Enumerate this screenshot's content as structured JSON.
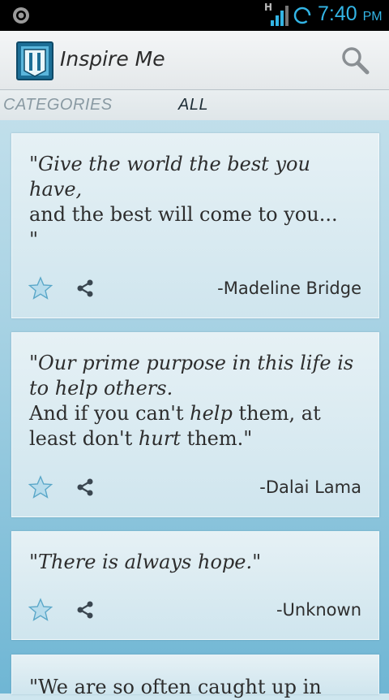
{
  "status_bar": {
    "network_type": "H",
    "time": "7:40",
    "ampm": "PM",
    "accent_color": "#33b5e5",
    "icons": [
      "notification-circle-icon",
      "signal-icon",
      "sync-icon"
    ]
  },
  "action_bar": {
    "title": "Inspire Me",
    "icons": [
      "app-logo-icon",
      "search-icon"
    ]
  },
  "tabs": [
    {
      "label": "CATEGORIES",
      "selected": false
    },
    {
      "label": "ALL",
      "selected": true
    }
  ],
  "quotes": [
    {
      "open": "\"",
      "italic": "Give the world the best you have,",
      "rest": "and the best will come to you...",
      "close": "\"",
      "author": "-Madeline Bridge"
    },
    {
      "open": "\"",
      "italic": "Our prime purpose in this life is to help others.",
      "line2_a": "And if you can't ",
      "line2_help": "help",
      "line2_b": " them, at least don't ",
      "line2_hurt": "hurt",
      "line2_c": " them.\"",
      "author": "-Dalai Lama"
    },
    {
      "open": "\"",
      "italic": "There is always hope.",
      "close": "\"",
      "author": "-Unknown"
    },
    {
      "text": "\"We are so often caught up in"
    }
  ]
}
